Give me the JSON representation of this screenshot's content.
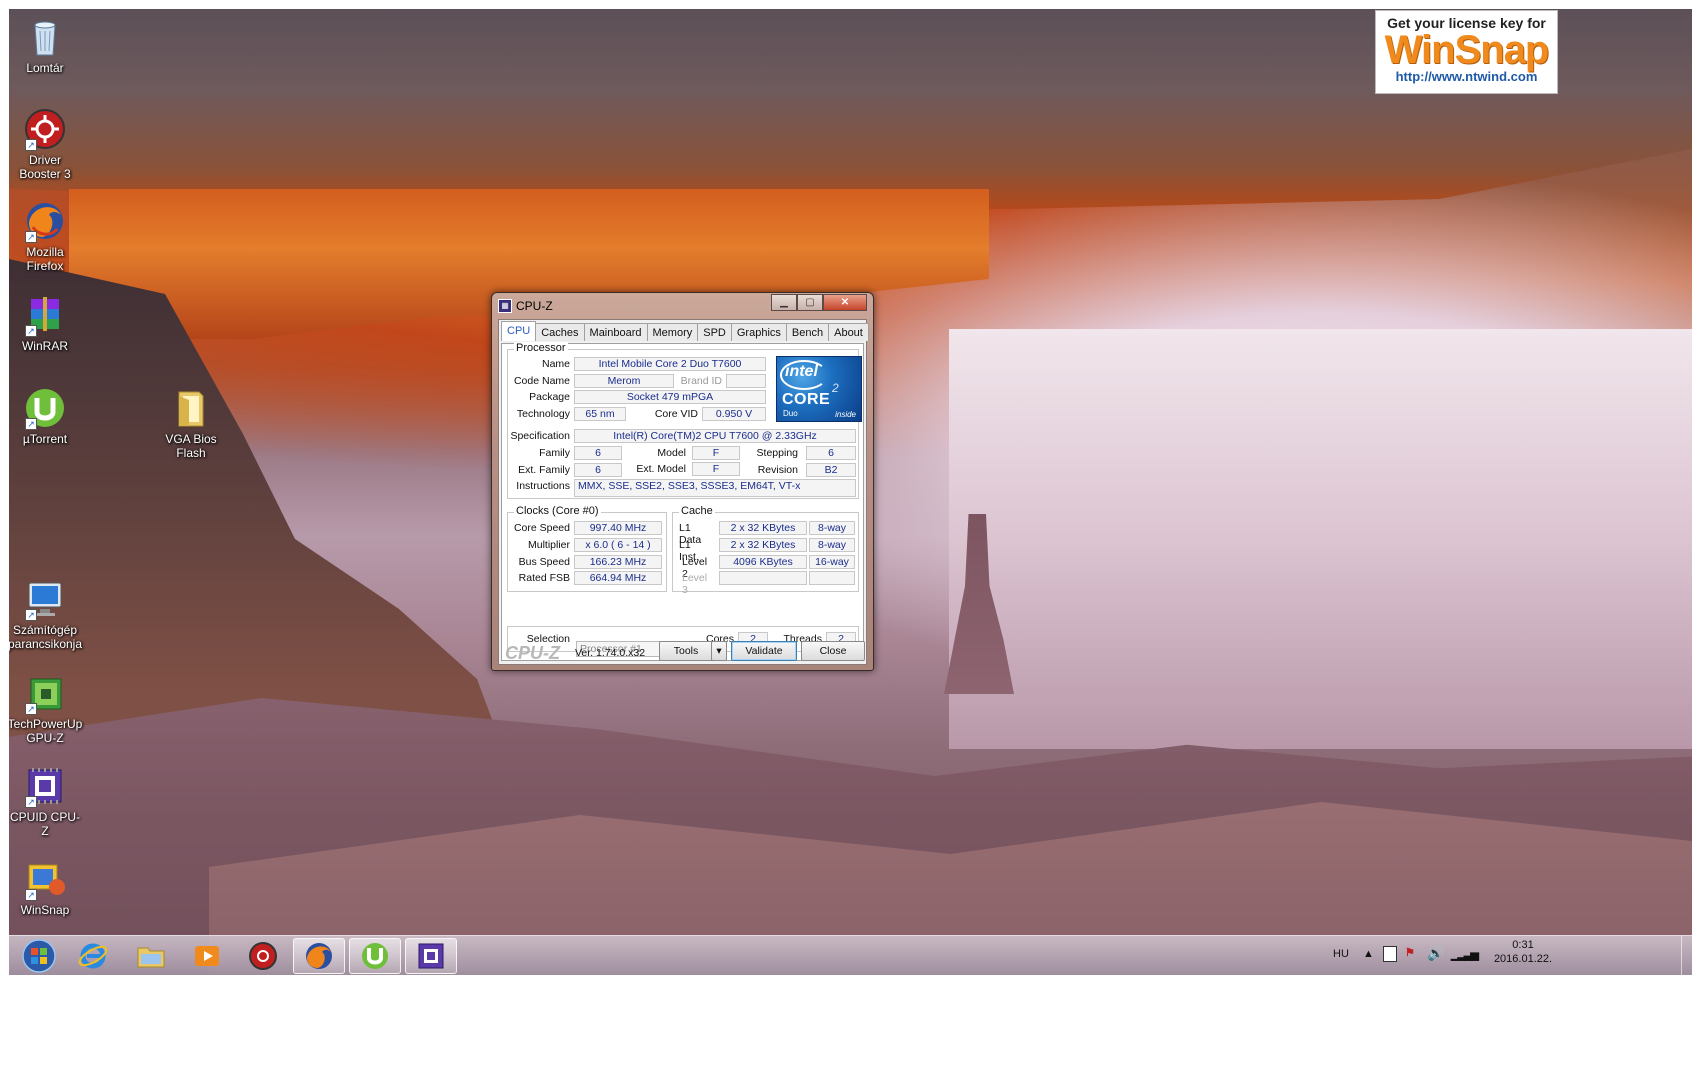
{
  "desktop": {
    "icons": [
      {
        "label": "Lomtár",
        "icon": "recycle-bin-icon"
      },
      {
        "label": "Driver Booster 3",
        "icon": "driver-booster-icon"
      },
      {
        "label": "Mozilla Firefox",
        "icon": "firefox-icon"
      },
      {
        "label": "WinRAR",
        "icon": "winrar-icon"
      },
      {
        "label": "µTorrent",
        "icon": "utorrent-icon"
      },
      {
        "label": "VGA Bios Flash",
        "icon": "folder-icon"
      },
      {
        "label": "Számítógép parancsikonja",
        "icon": "computer-icon"
      },
      {
        "label": "TechPowerUp GPU-Z",
        "icon": "gpu-z-icon"
      },
      {
        "label": "CPUID CPU-Z",
        "icon": "cpu-z-icon"
      },
      {
        "label": "WinSnap",
        "icon": "winsnap-icon"
      }
    ]
  },
  "ad": {
    "line1": "Get your license key for",
    "brand": "WinSnap",
    "url": "http://www.ntwind.com"
  },
  "cpuz": {
    "title": "CPU-Z",
    "tabs": [
      "CPU",
      "Caches",
      "Mainboard",
      "Memory",
      "SPD",
      "Graphics",
      "Bench",
      "About"
    ],
    "active_tab": "CPU",
    "processor": {
      "group_label": "Processor",
      "name_label": "Name",
      "name": "Intel Mobile Core 2 Duo T7600",
      "codename_label": "Code Name",
      "codename": "Merom",
      "brandid_label": "Brand ID",
      "brandid": "",
      "package_label": "Package",
      "package": "Socket 479 mPGA",
      "technology_label": "Technology",
      "technology": "65 nm",
      "corevid_label": "Core VID",
      "corevid": "0.950 V",
      "spec_label": "Specification",
      "spec": "Intel(R) Core(TM)2 CPU        T7600  @ 2.33GHz",
      "family_label": "Family",
      "family": "6",
      "model_label": "Model",
      "model": "F",
      "stepping_label": "Stepping",
      "stepping": "6",
      "extfamily_label": "Ext. Family",
      "extfamily": "6",
      "extmodel_label": "Ext. Model",
      "extmodel": "F",
      "revision_label": "Revision",
      "revision": "B2",
      "instructions_label": "Instructions",
      "instructions": "MMX, SSE, SSE2, SSE3, SSSE3, EM64T, VT-x"
    },
    "logo": {
      "brand": "intel",
      "product": "CORE",
      "sup": "2",
      "sub": "Duo",
      "tag": "inside"
    },
    "clocks": {
      "group_label": "Clocks (Core #0)",
      "core_speed_label": "Core Speed",
      "core_speed": "997.40 MHz",
      "multiplier_label": "Multiplier",
      "multiplier": "x 6.0 ( 6 - 14 )",
      "bus_speed_label": "Bus Speed",
      "bus_speed": "166.23 MHz",
      "rated_fsb_label": "Rated FSB",
      "rated_fsb": "664.94 MHz"
    },
    "cache": {
      "group_label": "Cache",
      "l1data_label": "L1 Data",
      "l1data": "2 x 32 KBytes",
      "l1data_way": "8-way",
      "l1inst_label": "L1 Inst.",
      "l1inst": "2 x 32 KBytes",
      "l1inst_way": "8-way",
      "level2_label": "Level 2",
      "level2": "4096 KBytes",
      "level2_way": "16-way",
      "level3_label": "Level 3",
      "level3": "",
      "level3_way": ""
    },
    "selection": {
      "label": "Selection",
      "value": "Processor #1",
      "cores_label": "Cores",
      "cores": "2",
      "threads_label": "Threads",
      "threads": "2"
    },
    "footer": {
      "brand": "CPU-Z",
      "version": "Ver. 1.74.0.x32",
      "tools": "Tools",
      "validate": "Validate",
      "close": "Close"
    }
  },
  "taskbar": {
    "items": [
      "start-orb-icon",
      "internet-explorer-icon",
      "file-explorer-icon",
      "media-player-icon",
      "driver-booster-icon",
      "firefox-icon",
      "utorrent-icon",
      "cpu-z-icon"
    ],
    "lang": "HU",
    "time": "0:31",
    "date": "2016.01.22."
  }
}
